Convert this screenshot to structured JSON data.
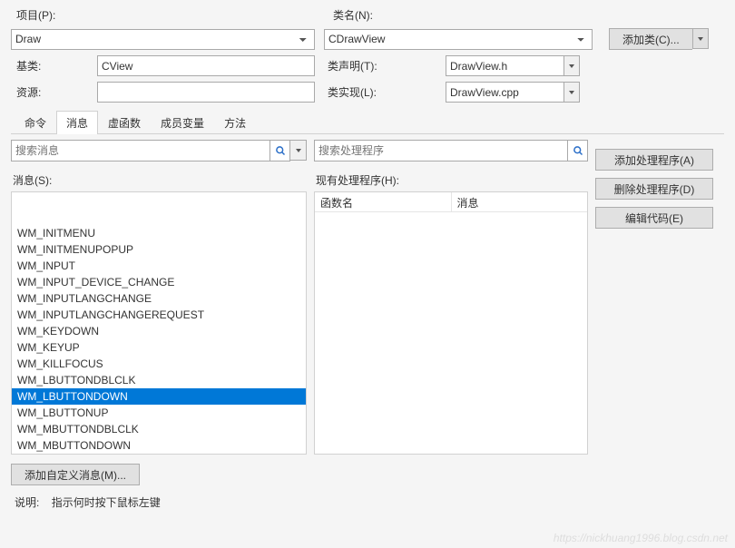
{
  "labels": {
    "project": "项目(P):",
    "className": "类名(N):",
    "baseClass": "基类:",
    "classDecl": "类声明(T):",
    "resource": "资源:",
    "classImpl": "类实现(L):",
    "addClass": "添加类(C)...",
    "searchMsgPh": "搜索消息",
    "searchHandlerPh": "搜索处理程序",
    "messages": "消息(S):",
    "handlers": "现有处理程序(H):",
    "colFunc": "函数名",
    "colMsg": "消息",
    "addHandler": "添加处理程序(A)",
    "delHandler": "删除处理程序(D)",
    "editCode": "编辑代码(E)",
    "addCustom": "添加自定义消息(M)...",
    "descLabel": "说明:",
    "descText": "指示何时按下鼠标左键"
  },
  "fields": {
    "project": "Draw",
    "className": "CDrawView",
    "baseClass": "CView",
    "classDecl": "DrawView.h",
    "resource": "",
    "classImpl": "DrawView.cpp"
  },
  "tabs": [
    "命令",
    "消息",
    "虚函数",
    "成员变量",
    "方法"
  ],
  "activeTab": 1,
  "messagesList": [
    "WM_INITMENU",
    "WM_INITMENUPOPUP",
    "WM_INPUT",
    "WM_INPUT_DEVICE_CHANGE",
    "WM_INPUTLANGCHANGE",
    "WM_INPUTLANGCHANGEREQUEST",
    "WM_KEYDOWN",
    "WM_KEYUP",
    "WM_KILLFOCUS",
    "WM_LBUTTONDBLCLK",
    "WM_LBUTTONDOWN",
    "WM_LBUTTONUP",
    "WM_MBUTTONDBLCLK",
    "WM_MBUTTONDOWN"
  ],
  "selectedMessage": "WM_LBUTTONDOWN",
  "watermark": "https://nickhuang1996.blog.csdn.net"
}
